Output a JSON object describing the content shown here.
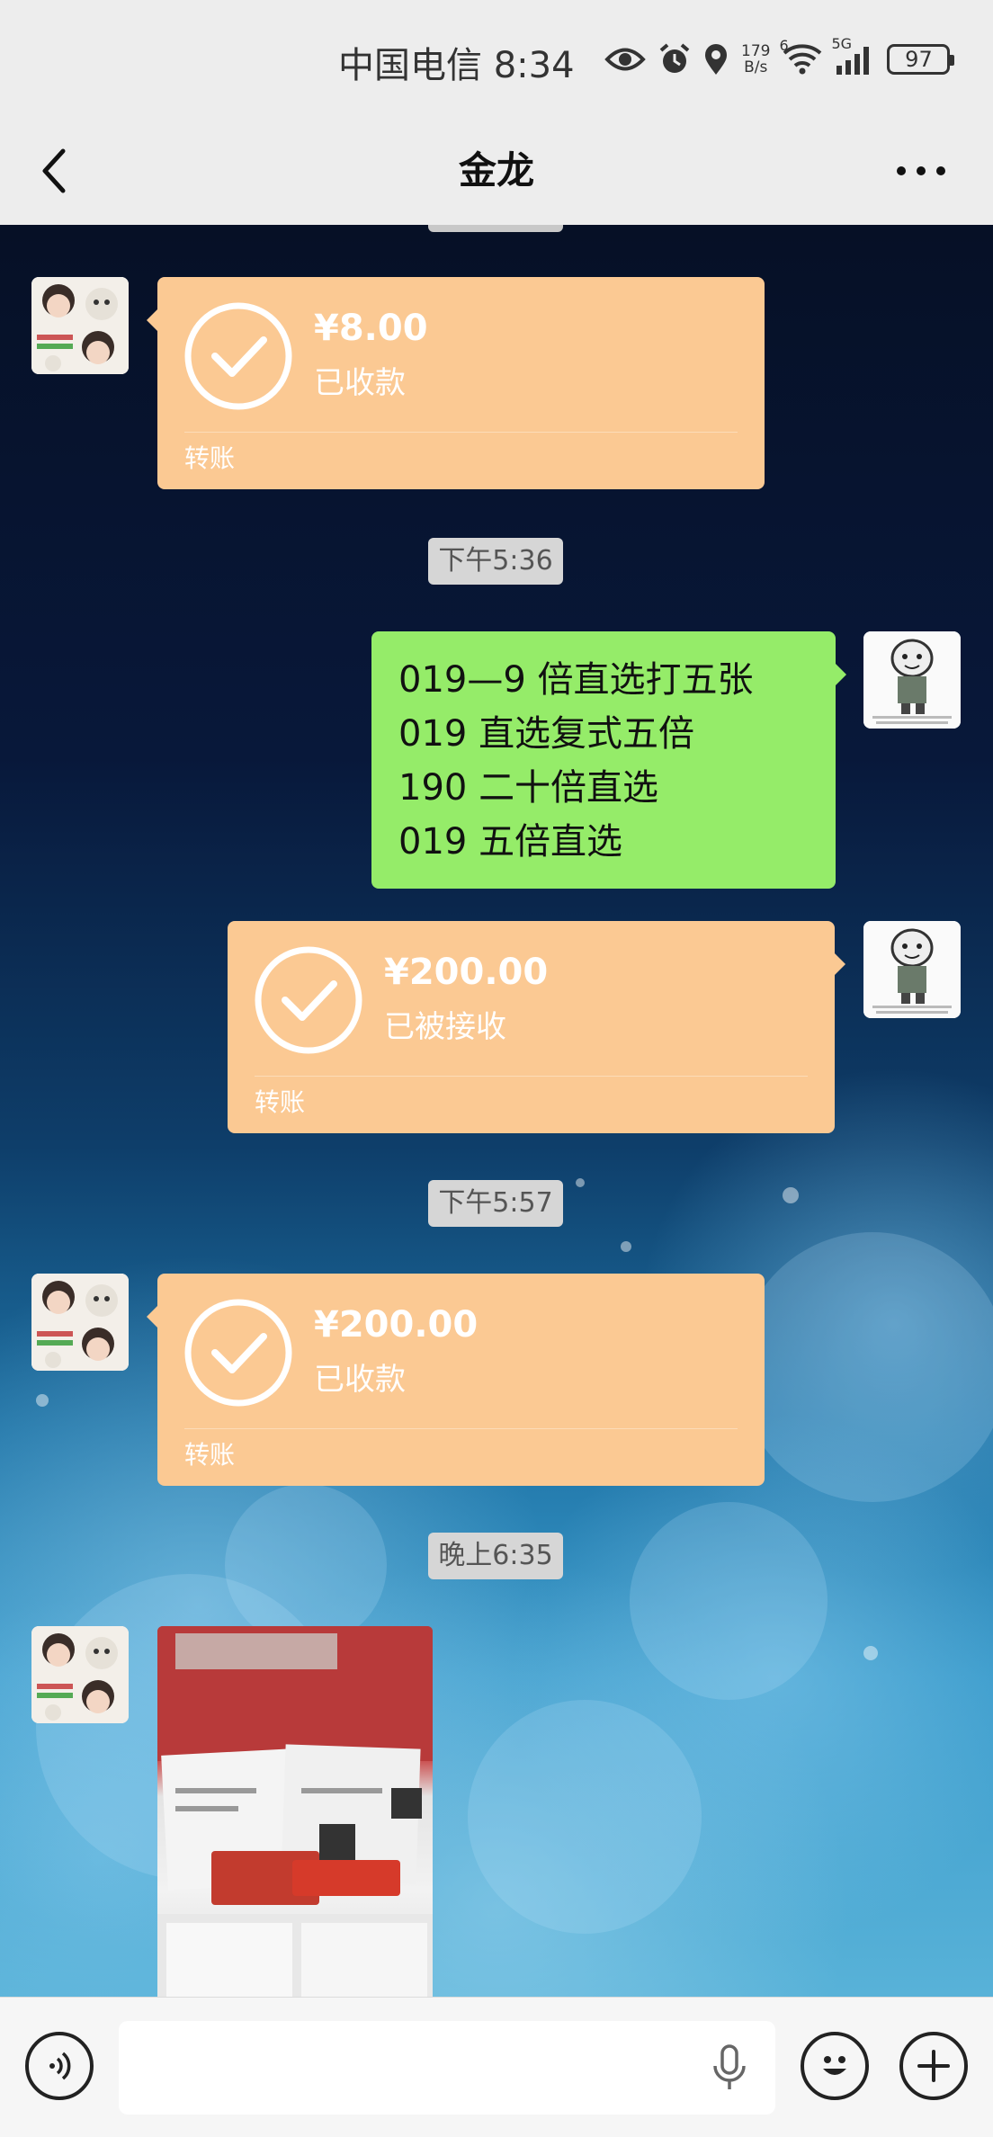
{
  "status_bar": {
    "carrier_time": "中国电信 8:34",
    "net_speed_value": "179",
    "net_speed_unit": "B/s",
    "wifi_tag": "6",
    "signal_tag": "5G",
    "battery": "97",
    "icons": [
      "eye-icon",
      "alarm-icon",
      "location-icon",
      "wifi-icon",
      "signal-icon",
      "battery-icon"
    ]
  },
  "header": {
    "title": "金龙",
    "back_icon": "chevron-left-icon",
    "more_icon": "more-dots-icon"
  },
  "messages": [
    {
      "type": "transfer",
      "side": "left",
      "amount": "¥8.00",
      "status": "已收款",
      "label": "转账"
    },
    {
      "type": "time",
      "text": "下午5:36"
    },
    {
      "type": "text",
      "side": "right",
      "lines": [
        "019—9 倍直选打五张",
        "019 直选复式五倍",
        "190 二十倍直选",
        "019 五倍直选"
      ]
    },
    {
      "type": "transfer",
      "side": "right",
      "amount": "¥200.00",
      "status": "已被接收",
      "label": "转账"
    },
    {
      "type": "time",
      "text": "下午5:57"
    },
    {
      "type": "transfer",
      "side": "left",
      "amount": "¥200.00",
      "status": "已收款",
      "label": "转账"
    },
    {
      "type": "time",
      "text": "晚上6:35"
    },
    {
      "type": "image",
      "side": "left",
      "description_icon": "photo-icon"
    }
  ],
  "input_bar": {
    "voice_icon": "voice-toggle-icon",
    "placeholder": "",
    "mic_icon": "microphone-icon",
    "emoji_icon": "emoji-icon",
    "plus_icon": "plus-icon"
  },
  "colors": {
    "transfer_bubble": "#fbc993",
    "my_text_bubble": "#95ec69",
    "time_pill": "#d6d6d6",
    "chrome": "#ededed"
  }
}
